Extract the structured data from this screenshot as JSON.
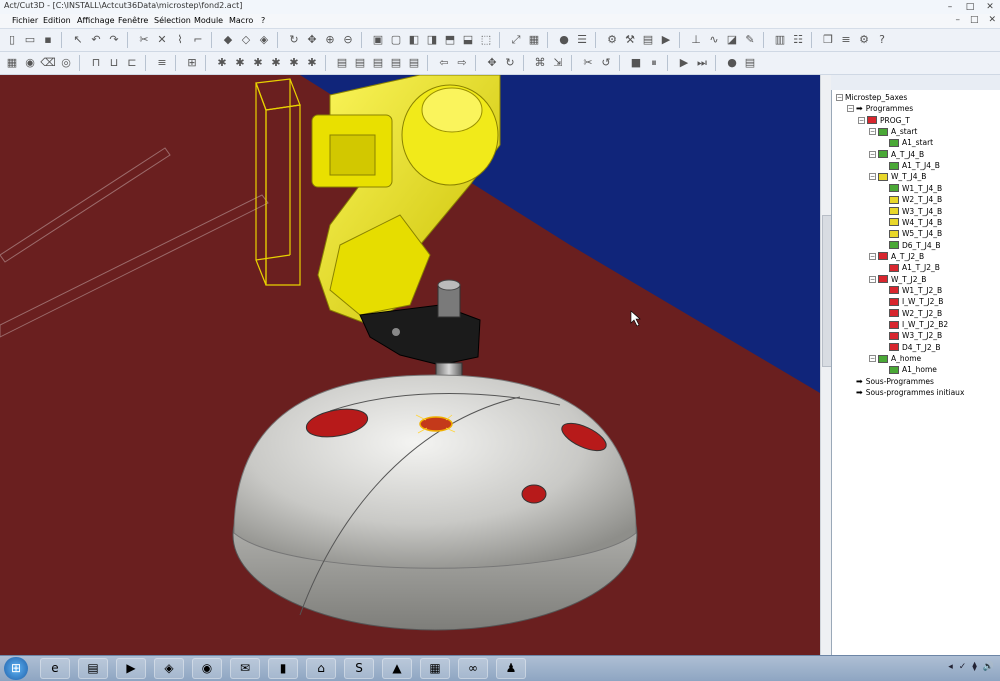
{
  "window": {
    "title": "Act/Cut3D - [C:\\INSTALL\\Actcut36Data\\microstep\\fond2.act]",
    "controls": [
      "–",
      "□",
      "✕"
    ]
  },
  "menubar": {
    "items": [
      "Fichier",
      "Edition",
      "Affichage",
      "Fenêtre",
      "Sélection",
      "Module",
      "Macro",
      "?"
    ],
    "doc_controls": [
      "–",
      "□",
      "✕"
    ]
  },
  "toolbar1": {
    "icons": [
      "new-icon",
      "open-icon",
      "save-icon",
      "sep",
      "select-arrow-icon",
      "undo-icon",
      "redo-icon",
      "sep",
      "cut-icon",
      "trim-icon",
      "link-icon",
      "corner-icon",
      "sep",
      "view-shaded-icon",
      "view-wire-icon",
      "view-color-icon",
      "sep",
      "rotate-icon",
      "pan-icon",
      "zoom-in-icon",
      "zoom-out-icon",
      "sep",
      "view-front-icon",
      "view-back-icon",
      "view-left-icon",
      "view-right-icon",
      "view-top-icon",
      "view-bottom-icon",
      "view-iso-icon",
      "sep",
      "fit-icon",
      "grid-icon",
      "sep",
      "sphere-icon",
      "layer-icon",
      "sep",
      "robot-icon",
      "tool-icon",
      "frame-icon",
      "play-icon",
      "sep",
      "axis-icon",
      "path-icon",
      "part-icon",
      "edit-icon",
      "sep",
      "table-icon",
      "props-icon",
      "sep",
      "cube-icon",
      "list-icon",
      "settings-icon",
      "help-icon"
    ]
  },
  "toolbar2": {
    "icons": [
      "grid-icon",
      "tag-icon",
      "erase-icon",
      "tag2-icon",
      "sep",
      "tool1-icon",
      "tool2-icon",
      "tool3-icon",
      "sep",
      "list-icon",
      "sep",
      "ruler-icon",
      "sep",
      "bulb1-icon",
      "bulb2-icon",
      "bulb3-icon",
      "bulb4-icon",
      "bulb5-icon",
      "bulb6-icon",
      "sep",
      "doc-icon",
      "doc2-icon",
      "doc3-icon",
      "doc4-icon",
      "doc5-icon",
      "sep",
      "arrow-left-icon",
      "arrow-right-icon",
      "sep",
      "move-icon",
      "rotate-icon",
      "sep",
      "mark-icon",
      "scale-icon",
      "sep",
      "cut-icon",
      "ccw-icon",
      "sep",
      "stop-icon",
      "pause-icon",
      "sep",
      "play-icon",
      "step-icon",
      "sep",
      "rec-icon",
      "frame-icon"
    ]
  },
  "tree": {
    "root": "Microstep_5axes",
    "nodes": [
      {
        "label": "Microstep_5axes",
        "level": 0,
        "exp": "−",
        "color": null
      },
      {
        "label": "Programmes",
        "level": 1,
        "exp": "−",
        "color": "arrow"
      },
      {
        "label": "PROG_T",
        "level": 2,
        "exp": "−",
        "color": "#d8262e"
      },
      {
        "label": "A_start",
        "level": 3,
        "exp": "−",
        "color": "#4aa836"
      },
      {
        "label": "A1_start",
        "level": 4,
        "exp": null,
        "color": "#4aa836"
      },
      {
        "label": "A_T_J4_B",
        "level": 3,
        "exp": "−",
        "color": "#4aa836"
      },
      {
        "label": "A1_T_J4_B",
        "level": 4,
        "exp": null,
        "color": "#4aa836"
      },
      {
        "label": "W_T_J4_B",
        "level": 3,
        "exp": "−",
        "color": "#e8d72a"
      },
      {
        "label": "W1_T_J4_B",
        "level": 4,
        "exp": null,
        "color": "#4aa836"
      },
      {
        "label": "W2_T_J4_B",
        "level": 4,
        "exp": null,
        "color": "#e8d72a"
      },
      {
        "label": "W3_T_J4_B",
        "level": 4,
        "exp": null,
        "color": "#e8d72a"
      },
      {
        "label": "W4_T_J4_B",
        "level": 4,
        "exp": null,
        "color": "#e8d72a"
      },
      {
        "label": "W5_T_J4_B",
        "level": 4,
        "exp": null,
        "color": "#e8d72a"
      },
      {
        "label": "D6_T_J4_B",
        "level": 4,
        "exp": null,
        "color": "#4aa836"
      },
      {
        "label": "A_T_J2_B",
        "level": 3,
        "exp": "−",
        "color": "#d8262e"
      },
      {
        "label": "A1_T_J2_B",
        "level": 4,
        "exp": null,
        "color": "#d8262e"
      },
      {
        "label": "W_T_J2_B",
        "level": 3,
        "exp": "−",
        "color": "#d8262e"
      },
      {
        "label": "W1_T_J2_B",
        "level": 4,
        "exp": null,
        "color": "#d8262e"
      },
      {
        "label": "I_W_T_J2_B",
        "level": 4,
        "exp": null,
        "color": "#d8262e"
      },
      {
        "label": "W2_T_J2_B",
        "level": 4,
        "exp": null,
        "color": "#d8262e"
      },
      {
        "label": "I_W_T_J2_B2",
        "level": 4,
        "exp": null,
        "color": "#d8262e"
      },
      {
        "label": "W3_T_J2_B",
        "level": 4,
        "exp": null,
        "color": "#d8262e"
      },
      {
        "label": "D4_T_J2_B",
        "level": 4,
        "exp": null,
        "color": "#d8262e"
      },
      {
        "label": "A_home",
        "level": 3,
        "exp": "−",
        "color": "#4aa836"
      },
      {
        "label": "A1_home",
        "level": 4,
        "exp": null,
        "color": "#4aa836"
      },
      {
        "label": "Sous-Programmes",
        "level": 1,
        "exp": null,
        "color": "arrow"
      },
      {
        "label": "Sous-programmes initiaux",
        "level": 1,
        "exp": null,
        "color": "arrow"
      }
    ]
  },
  "taskbar": {
    "apps": [
      "start-icon",
      "ie-icon",
      "explorer-icon",
      "media-player-icon",
      "puzzle-icon",
      "firefox-icon",
      "outlook-icon",
      "cmd-icon",
      "network-icon",
      "skype-icon",
      "excel-icon",
      "chart-icon",
      "glasses-icon",
      "figure-icon"
    ],
    "app_glyphs": [
      "⊞",
      "e",
      "▤",
      "▶",
      "◈",
      "◉",
      "✉",
      "▮",
      "⌂",
      "S",
      "▲",
      "▦",
      "∞",
      "♟"
    ],
    "tray": [
      "◂",
      "✓",
      "⧫",
      "🔊"
    ]
  }
}
